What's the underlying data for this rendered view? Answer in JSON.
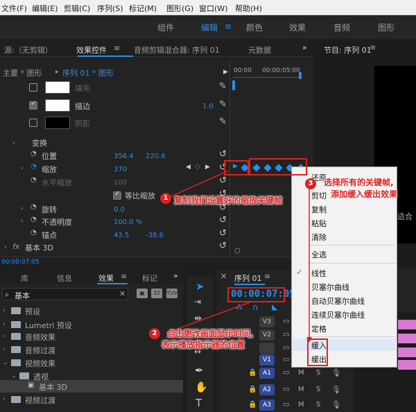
{
  "menu": [
    "文件(F)",
    "编辑(E)",
    "剪辑(C)",
    "序列(S)",
    "标记(M)",
    "图形(G)",
    "窗口(W)",
    "帮助(H)"
  ],
  "workspaces": [
    "组件",
    "编辑",
    "颜色",
    "效果",
    "音频",
    "图形"
  ],
  "left_tabs": {
    "source": "源:（无剪辑）",
    "effect_controls": "效果控件",
    "audio_mixer": "音频剪辑混合器: 序列 01",
    "metadata": "元数据"
  },
  "program_tab": "节目: 序列 01",
  "ec": {
    "master": "主要 * 图形",
    "sequence_clip": "序列 01 * 图形",
    "time1": "00:00",
    "time2": "00:00:05:00",
    "fill": "填充",
    "stroke": "描边",
    "stroke_width": "1.0",
    "shadow": "阴影",
    "transform": "变换",
    "position": "位置",
    "pos_x": "356.4",
    "pos_y": "220.6",
    "scale": "缩放",
    "scale_val": "370",
    "scale_w": "水平缩放",
    "scale_w_val": "100",
    "uniform": "等比缩放",
    "rotation": "旋转",
    "rotation_val": "0.0",
    "opacity": "不透明度",
    "opacity_val": "100.0 %",
    "anchor": "锚点",
    "anchor_x": "43.5",
    "anchor_y": "-38.6",
    "basic3d": "基本 3D",
    "fx": "fx",
    "timecode": "00:00:07:05"
  },
  "proj_tabs": [
    "库",
    "信息",
    "效果",
    "标记"
  ],
  "proj_search": "基本",
  "effects_tree": [
    "预设",
    "Lumetri 预设",
    "音频效果",
    "音频过渡",
    "视频效果",
    "透视",
    "基本 3D",
    "视频过渡"
  ],
  "timeline": {
    "tab": "序列 01",
    "timecode": "00:00:07:05",
    "tracks": [
      "V3",
      "V2",
      "V1",
      "A1",
      "A2",
      "A3"
    ],
    "m": "M",
    "s": "S"
  },
  "context_menu": [
    "还原",
    "剪切",
    "复制",
    "粘贴",
    "清除",
    "全选",
    "线性",
    "贝塞尔曲线",
    "自动贝塞尔曲线",
    "连续贝塞尔曲线",
    "定格",
    "缓入",
    "缓出"
  ],
  "right_edge_label": "适合",
  "callouts": {
    "c1_num": "1",
    "c1": "复制我们设置好的缩放关键帧",
    "c2_num": "2",
    "c2a": "点击更改画面显示时间,",
    "c2b": "表示播放指示器的位置",
    "c3_num": "3",
    "c3a": "选择所有的关键帧,",
    "c3b": "添加缓入缓出效果"
  },
  "icons": {
    "dropdown": "chevron-right-icon",
    "overflow": "double-chevron-icon",
    "reset": "reset-icon",
    "pen": "pen-icon",
    "selection": "selection-tool-icon"
  }
}
